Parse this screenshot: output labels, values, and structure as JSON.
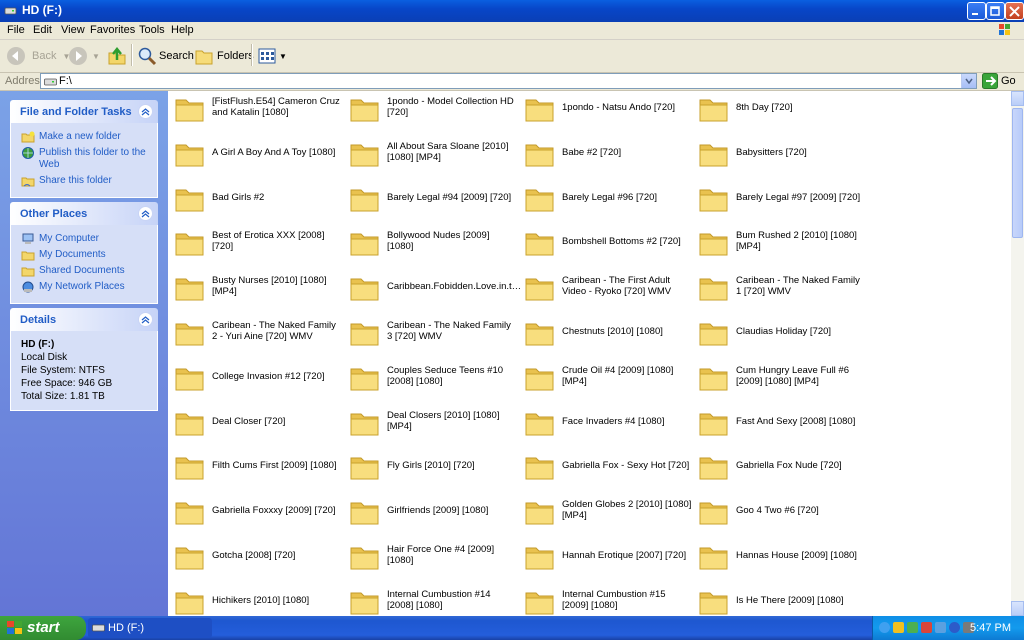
{
  "window": {
    "title": "HD (F:)"
  },
  "menu": [
    "File",
    "Edit",
    "View",
    "Favorites",
    "Tools",
    "Help"
  ],
  "toolbar": {
    "back": "Back",
    "search": "Search",
    "folders": "Folders"
  },
  "address": {
    "label": "Address",
    "value": "F:\\",
    "go": "Go"
  },
  "tasks_panel": {
    "title": "File and Folder Tasks",
    "items": [
      "Make a new folder",
      "Publish this folder to the Web",
      "Share this folder"
    ]
  },
  "places_panel": {
    "title": "Other Places",
    "items": [
      "My Computer",
      "My Documents",
      "Shared Documents",
      "My Network Places"
    ]
  },
  "details_panel": {
    "title": "Details",
    "name": "HD (F:)",
    "type": "Local Disk",
    "filesystem": "File System: NTFS",
    "free": "Free Space: 946 GB",
    "total": "Total Size: 1.81 TB"
  },
  "folders": [
    "[FistFlush.E54] Cameron Cruz and Katalin [1080]",
    "1pondo - Model Collection HD [720]",
    "1pondo - Natsu Ando [720]",
    "8th Day [720]",
    "A Girl A Boy And A Toy [1080]",
    "All About Sara Sloane [2010] [1080] [MP4]",
    "Babe #2 [720]",
    "Babysitters [720]",
    "Bad Girls #2",
    "Barely Legal #94 [2009] [720]",
    "Barely Legal #96 [720]",
    "Barely Legal #97 [2009] [720]",
    "Best of Erotica XXX [2008] [720]",
    "Bollywood Nudes [2009] [1080]",
    "Bombshell Bottoms #2 [720]",
    "Bum Rushed 2 [2010] [1080] [MP4]",
    "Busty Nurses [2010] [1080] [MP4]",
    "Caribbean.Fobidden.Love.in.t…",
    "Caribean - The First Adult Video - Ryoko [720] WMV",
    "Caribean - The Naked Family 1 [720] WMV",
    "Caribean - The Naked Family 2 - Yuri Aine [720] WMV",
    "Caribean - The Naked Family 3 [720] WMV",
    "Chestnuts [2010] [1080]",
    "Claudias Holiday [720]",
    "College Invasion #12 [720]",
    "Couples Seduce Teens #10 [2008] [1080]",
    "Crude Oil #4 [2009] [1080] [MP4]",
    "Cum Hungry Leave Full #6 [2009] [1080] [MP4]",
    "Deal Closer [720]",
    "Deal Closers [2010] [1080] [MP4]",
    "Face Invaders #4 [1080]",
    "Fast And Sexy [2008] [1080]",
    "Filth Cums First [2009] [1080]",
    "Fly Girls [2010] [720]",
    "Gabriella Fox - Sexy Hot [720]",
    "Gabriella Fox Nude [720]",
    "Gabriella Foxxxy [2009] [720]",
    "Girlfriends [2009] [1080]",
    "Golden Globes 2 [2010] [1080] [MP4]",
    "Goo 4 Two #6 [720]",
    "Gotcha [2008] [720]",
    "Hair Force One #4 [2009] [1080]",
    "Hannah Erotique [2007] [720]",
    "Hannas House [2009] [1080]",
    "Hichikers [2010] [1080]",
    "Internal Cumbustion #14 [2008] [1080]",
    "Internal Cumbustion #15 [2009] [1080]",
    "Is He There [2009] [1080]"
  ],
  "taskbar": {
    "start": "start",
    "task": "HD (F:)",
    "clock": "5:47 PM"
  }
}
